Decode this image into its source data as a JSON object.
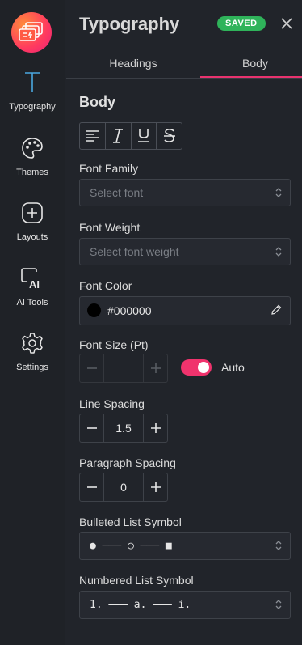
{
  "rail": {
    "items": [
      {
        "label": "Typography",
        "icon": "typography-icon"
      },
      {
        "label": "Themes",
        "icon": "palette-icon"
      },
      {
        "label": "Layouts",
        "icon": "add-layout-icon"
      },
      {
        "label": "AI Tools",
        "icon": "ai-tools-icon"
      },
      {
        "label": "Settings",
        "icon": "gear-icon"
      }
    ]
  },
  "header": {
    "title": "Typography",
    "badge": "SAVED"
  },
  "tabs": [
    {
      "label": "Headings"
    },
    {
      "label": "Body"
    }
  ],
  "active_tab": "Body",
  "section": {
    "title": "Body"
  },
  "font_family": {
    "label": "Font Family",
    "placeholder": "Select font"
  },
  "font_weight": {
    "label": "Font Weight",
    "placeholder": "Select font weight"
  },
  "font_color": {
    "label": "Font Color",
    "value": "#000000"
  },
  "font_size": {
    "label": "Font Size (Pt)",
    "value": "",
    "auto_label": "Auto",
    "auto_on": true
  },
  "line_spacing": {
    "label": "Line Spacing",
    "value": "1.5"
  },
  "paragraph_spacing": {
    "label": "Paragraph Spacing",
    "value": "0"
  },
  "bulleted": {
    "label": "Bulleted List Symbol",
    "value": "● ─── ○ ─── ■"
  },
  "numbered": {
    "label": "Numbered List Symbol",
    "value": "1. ─── a. ─── i."
  },
  "colors": {
    "background": "#21242a",
    "accent": "#e8336f",
    "saved": "#2fb35a",
    "typography_icon": "#4aa8e0"
  }
}
